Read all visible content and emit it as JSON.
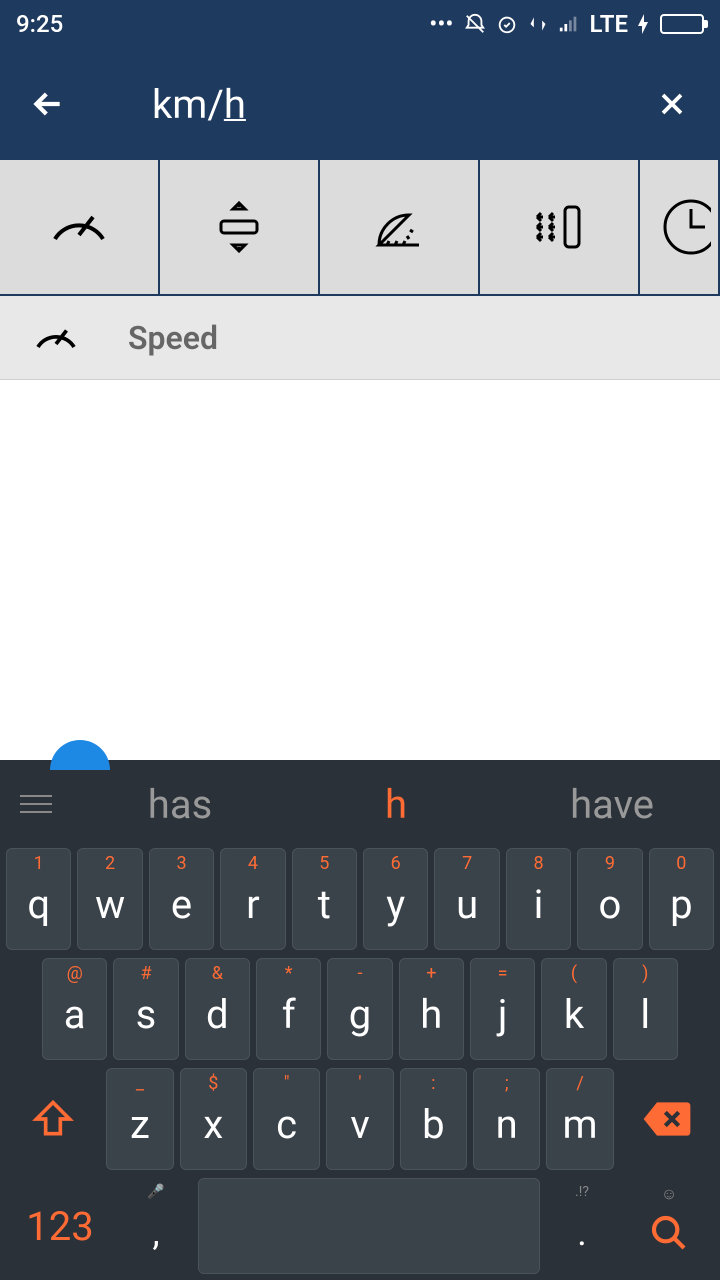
{
  "status": {
    "time": "9:25",
    "network": "LTE"
  },
  "appbar": {
    "search_value": "km/",
    "search_cursor_char": "h"
  },
  "tabs": [
    {
      "name": "speed-icon"
    },
    {
      "name": "compress-icon"
    },
    {
      "name": "angle-icon"
    },
    {
      "name": "vibration-icon"
    },
    {
      "name": "clock-icon"
    }
  ],
  "result": {
    "label": "Speed"
  },
  "keyboard": {
    "suggestions": [
      "has",
      "h",
      "have"
    ],
    "active_suggestion_index": 1,
    "row1": [
      {
        "sym": "1",
        "main": "q"
      },
      {
        "sym": "2",
        "main": "w"
      },
      {
        "sym": "3",
        "main": "e"
      },
      {
        "sym": "4",
        "main": "r"
      },
      {
        "sym": "5",
        "main": "t"
      },
      {
        "sym": "6",
        "main": "y"
      },
      {
        "sym": "7",
        "main": "u"
      },
      {
        "sym": "8",
        "main": "i"
      },
      {
        "sym": "9",
        "main": "o"
      },
      {
        "sym": "0",
        "main": "p"
      }
    ],
    "row2": [
      {
        "sym": "@",
        "main": "a"
      },
      {
        "sym": "#",
        "main": "s"
      },
      {
        "sym": "&",
        "main": "d"
      },
      {
        "sym": "*",
        "main": "f"
      },
      {
        "sym": "-",
        "main": "g"
      },
      {
        "sym": "+",
        "main": "h"
      },
      {
        "sym": "=",
        "main": "j"
      },
      {
        "sym": "(",
        "main": "k"
      },
      {
        "sym": ")",
        "main": "l"
      }
    ],
    "row3": [
      {
        "sym": "_",
        "main": "z"
      },
      {
        "sym": "$",
        "main": "x"
      },
      {
        "sym": "\"",
        "main": "c"
      },
      {
        "sym": "'",
        "main": "v"
      },
      {
        "sym": ":",
        "main": "b"
      },
      {
        "sym": ";",
        "main": "n"
      },
      {
        "sym": "/",
        "main": "m"
      }
    ],
    "bottom": {
      "num_label": "123",
      "comma_tiny": "🎤",
      "comma": ",",
      "dot_tiny": ".!?",
      "dot": ".",
      "search_tiny": "☺"
    }
  }
}
